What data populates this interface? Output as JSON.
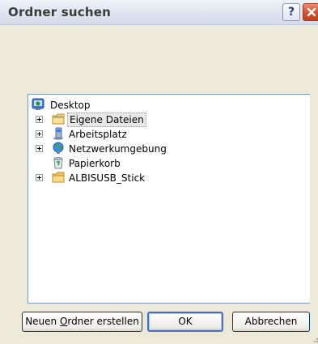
{
  "window": {
    "title": "Ordner suchen",
    "help_glyph": "?",
    "close_glyph": "✕"
  },
  "tree": {
    "root": {
      "label": "Desktop",
      "icon": "desktop-icon"
    },
    "items": [
      {
        "label": "Eigene Dateien",
        "icon": "my-documents-icon",
        "expandable": true,
        "selected": true
      },
      {
        "label": "Arbeitsplatz",
        "icon": "my-computer-icon",
        "expandable": true,
        "selected": false
      },
      {
        "label": "Netzwerkumgebung",
        "icon": "network-places-icon",
        "expandable": true,
        "selected": false
      },
      {
        "label": "Papierkorb",
        "icon": "recycle-bin-icon",
        "expandable": false,
        "selected": false
      },
      {
        "label": "ALBISUSB_Stick",
        "icon": "folder-icon",
        "expandable": true,
        "selected": false
      }
    ]
  },
  "buttons": {
    "new_folder_before": "Neuen ",
    "new_folder_accel": "O",
    "new_folder_after": "rdner erstellen",
    "ok": "OK",
    "cancel": "Abbrechen"
  },
  "colors": {
    "dialog_bg": "#ece9d8",
    "title_text": "#3b3b3b",
    "tree_border": "#7f9db9",
    "default_button_ring": "#4a6fc7",
    "close_button": "#d2502f"
  }
}
